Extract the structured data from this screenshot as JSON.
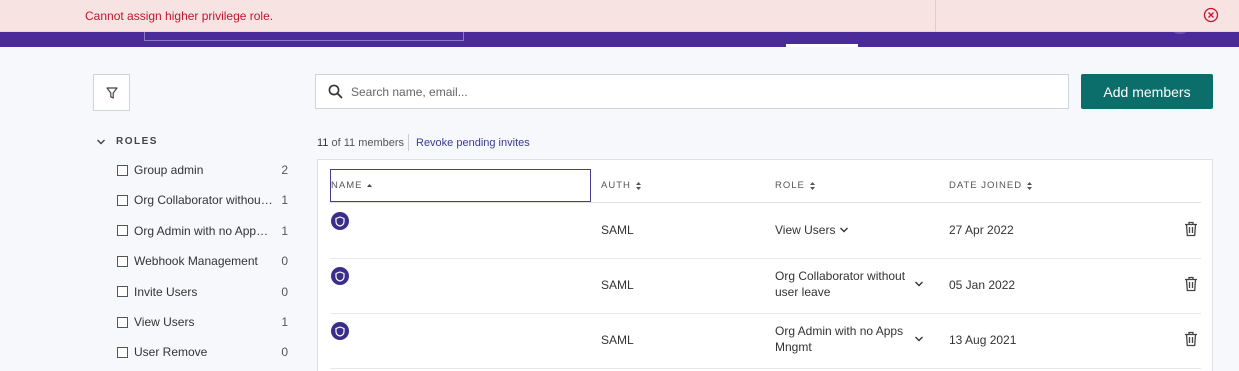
{
  "error_banner": {
    "message": "Cannot assign higher privilege role.",
    "close_icon": "close-circle-icon",
    "color": "#c0152f"
  },
  "toolbar": {
    "filter_icon": "filter-icon",
    "search_placeholder": "Search name, email...",
    "search_value": "",
    "add_members_label": "Add members",
    "accent_color": "#0c6e6a"
  },
  "roles_filter": {
    "title": "ROLES",
    "items": [
      {
        "label": "Group admin",
        "count": "2"
      },
      {
        "label": "Org Collaborator without user leave",
        "count": "1"
      },
      {
        "label": "Org Admin with no Apps Mngmt",
        "count": "1"
      },
      {
        "label": "Webhook Management",
        "count": "0"
      },
      {
        "label": "Invite Users",
        "count": "0"
      },
      {
        "label": "View Users",
        "count": "1"
      },
      {
        "label": "User Remove",
        "count": "0"
      }
    ]
  },
  "members": {
    "count_current": "11",
    "count_text": "of 11 members",
    "revoke_label": "Revoke pending invites",
    "columns": [
      "NAME",
      "AUTH",
      "ROLE",
      "DATE JOINED"
    ],
    "rows": [
      {
        "auth": "SAML",
        "role": "View Users",
        "date_joined": "27 Apr 2022"
      },
      {
        "auth": "SAML",
        "role": "Org Collaborator without user leave",
        "date_joined": "05 Jan 2022"
      },
      {
        "auth": "SAML",
        "role": "Org Admin with no Apps Mngmt",
        "date_joined": "13 Aug 2021"
      }
    ]
  }
}
